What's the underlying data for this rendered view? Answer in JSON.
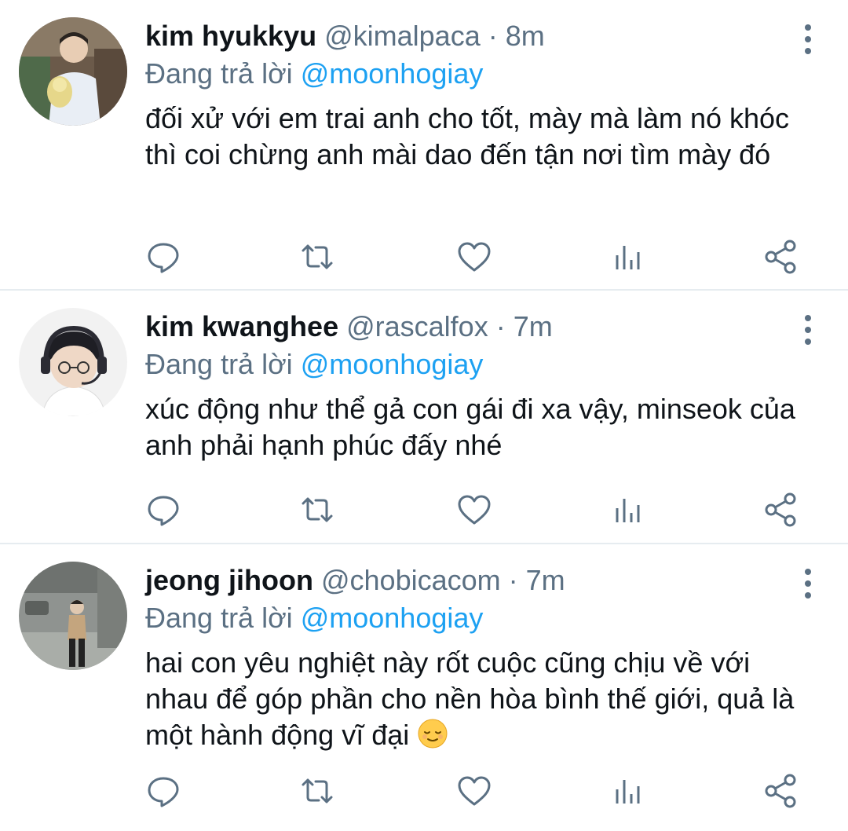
{
  "tweets": [
    {
      "name": "kim hyukkyu",
      "handle": "@kimalpaca",
      "separator": "·",
      "time": "8m",
      "reply_prefix": "Đang trả lời",
      "reply_to": "@moonhogiay",
      "text": "đối xử với em trai anh cho tốt, mày mà làm nó khóc thì coi chừng anh mài dao đến tận nơi tìm mày đó",
      "avatar_icon": "avatar-photo"
    },
    {
      "name": "kim kwanghee",
      "handle": "@rascalfox",
      "separator": "·",
      "time": "7m",
      "reply_prefix": "Đang trả lời",
      "reply_to": "@moonhogiay",
      "text": "xúc động như thể gả con gái đi xa vậy, minseok của anh phải hạnh phúc đấy nhé",
      "avatar_icon": "avatar-photo"
    },
    {
      "name": "jeong jihoon",
      "handle": "@chobicacom",
      "separator": "·",
      "time": "7m",
      "reply_prefix": "Đang trả lời",
      "reply_to": "@moonhogiay",
      "text": "hai con yêu nghiệt này rốt cuộc cũng chịu về với nhau để góp phần cho nền hòa bình thế giới, quả là một hành động vĩ đại",
      "emoji": "relieved-face-icon",
      "avatar_icon": "avatar-photo"
    }
  ],
  "actions": [
    "reply-icon",
    "retweet-icon",
    "like-icon",
    "stats-icon",
    "share-icon"
  ],
  "colors": {
    "name": "#0f1419",
    "secondary": "#5b7083",
    "mention": "#1da1f2",
    "divider": "#e6ecf0"
  }
}
